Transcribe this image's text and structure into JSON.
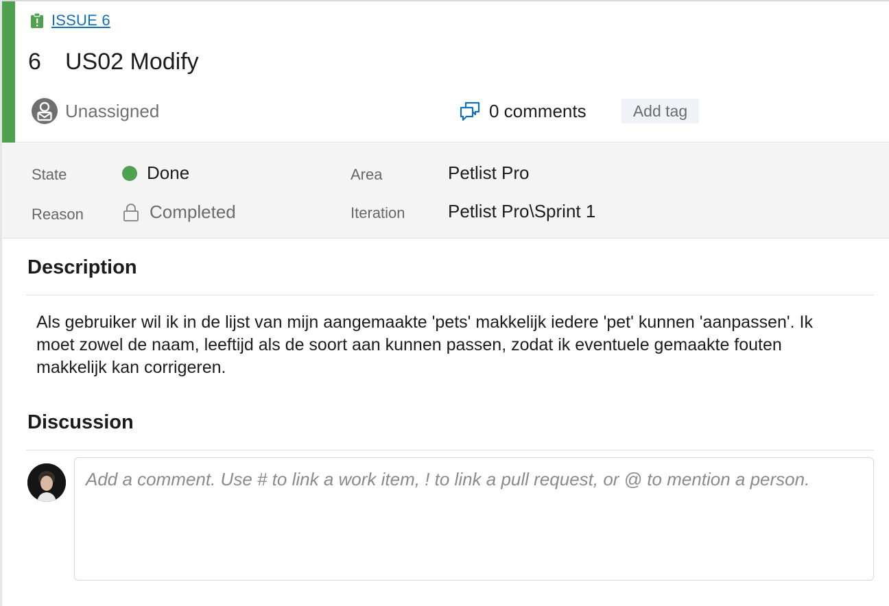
{
  "header": {
    "type_label": "ISSUE 6",
    "id": "6",
    "title": "US02 Modify",
    "assignee": "Unassigned",
    "comments": "0 comments",
    "add_tag": "Add tag",
    "accent_color": "#4fa04f"
  },
  "fields": {
    "state_label": "State",
    "state_value": "Done",
    "state_color": "#4fa04f",
    "reason_label": "Reason",
    "reason_value": "Completed",
    "area_label": "Area",
    "area_value": "Petlist Pro",
    "iteration_label": "Iteration",
    "iteration_value": "Petlist Pro\\Sprint 1"
  },
  "description": {
    "title": "Description",
    "text": "Als gebruiker wil ik in de lijst van mijn aangemaakte 'pets' makkelijk iedere 'pet' kunnen 'aanpassen'. Ik moet zowel de naam, leeftijd als de soort aan kunnen passen, zodat ik eventuele gemaakte fouten makkelijk kan corrigeren."
  },
  "discussion": {
    "title": "Discussion",
    "placeholder": "Add a comment. Use # to link a work item, ! to link a pull request, or @ to mention a person."
  },
  "icons": {
    "type": "issue-clipboard-icon",
    "assignee": "unassigned-user-icon",
    "comments": "comments-icon",
    "reason": "lock-icon",
    "commenter": "user-avatar"
  }
}
